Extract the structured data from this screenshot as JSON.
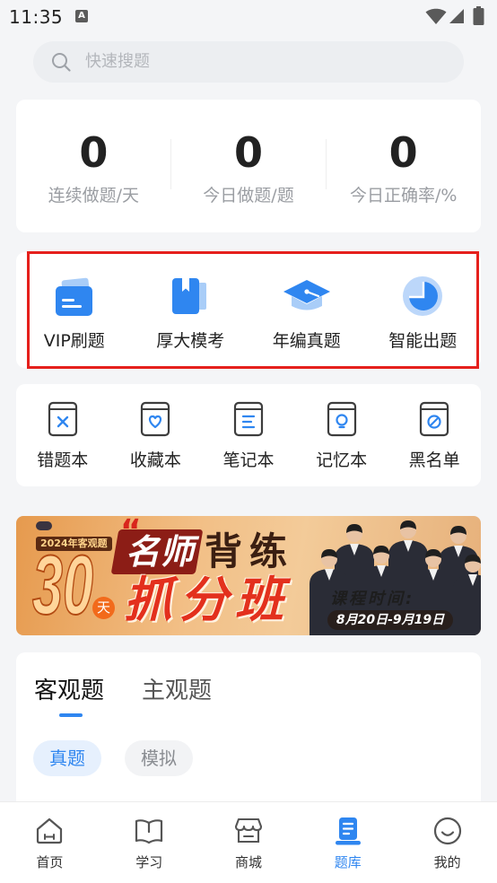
{
  "status_bar": {
    "time": "11:35",
    "notification_glyph": "A"
  },
  "search": {
    "placeholder": "快速搜题"
  },
  "stats": [
    {
      "value": "0",
      "label": "连续做题/天"
    },
    {
      "value": "0",
      "label": "今日做题/题"
    },
    {
      "value": "0",
      "label": "今日正确率/%"
    }
  ],
  "features": [
    {
      "label": "VIP刷题",
      "icon": "vip-practice-icon"
    },
    {
      "label": "厚大模考",
      "icon": "mock-exam-book-icon"
    },
    {
      "label": "年编真题",
      "icon": "graduation-cap-icon"
    },
    {
      "label": "智能出题",
      "icon": "pie-chart-icon"
    }
  ],
  "tools": [
    {
      "label": "错题本",
      "icon": "wrong-questions-icon"
    },
    {
      "label": "收藏本",
      "icon": "favorites-heart-icon"
    },
    {
      "label": "笔记本",
      "icon": "notes-icon"
    },
    {
      "label": "记忆本",
      "icon": "memory-bulb-icon"
    },
    {
      "label": "黑名单",
      "icon": "blacklist-icon"
    }
  ],
  "banner": {
    "badge": "2024年客观题",
    "days_number": "30",
    "days_unit": "天",
    "quote_mark": "“",
    "title_highlight": "名师",
    "title_rest": "背练",
    "subtitle": "抓分班",
    "schedule_label": "课程时间:",
    "schedule_dates": "8月20日-9月19日"
  },
  "subject_tabs": [
    {
      "label": "客观题",
      "active": true
    },
    {
      "label": "主观题",
      "active": false
    }
  ],
  "filter_chips": [
    {
      "label": "真题",
      "active": true
    },
    {
      "label": "模拟",
      "active": false
    }
  ],
  "bottom_nav": [
    {
      "label": "首页",
      "icon": "home-icon",
      "active": false
    },
    {
      "label": "学习",
      "icon": "study-book-icon",
      "active": false
    },
    {
      "label": "商城",
      "icon": "store-icon",
      "active": false
    },
    {
      "label": "题库",
      "icon": "question-bank-icon",
      "active": true
    },
    {
      "label": "我的",
      "icon": "profile-smile-icon",
      "active": false
    }
  ],
  "colors": {
    "accent": "#2f86f0",
    "accent_light": "#a9cdf8",
    "highlight_border": "#e5201c",
    "page_background": "#f4f5f7",
    "text_primary": "#222222",
    "text_secondary": "#9a9da2"
  }
}
